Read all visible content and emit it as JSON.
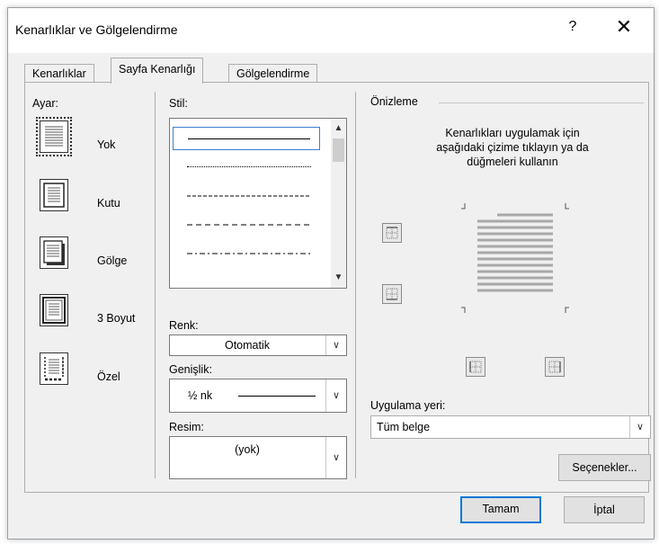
{
  "window": {
    "title": "Kenarlıklar ve Gölgelendirme",
    "help_glyph": "?",
    "close_glyph": "✕"
  },
  "tabs": [
    {
      "label": "Kenarlıklar",
      "underline": "e",
      "active": false
    },
    {
      "label": "Sayfa Kenarlığı",
      "underline": "S",
      "active": true
    },
    {
      "label": "Gölgelendirme",
      "underline": "ö",
      "active": false
    }
  ],
  "setting": {
    "label": "Ayar:",
    "items": [
      {
        "label": "Yok",
        "icon": "setting-none-icon",
        "selected": true
      },
      {
        "label": "Kutu",
        "icon": "setting-box-icon",
        "selected": false
      },
      {
        "label": "Gölge",
        "icon": "setting-shadow-icon",
        "selected": false
      },
      {
        "label": "3 Boyut",
        "icon": "setting-3d-icon",
        "selected": false
      },
      {
        "label": "Özel",
        "icon": "setting-custom-icon",
        "selected": false
      }
    ]
  },
  "style": {
    "label": "Stil:",
    "items": [
      "solid",
      "dotted",
      "dashed-small",
      "dashed-large",
      "dash-dot"
    ]
  },
  "color": {
    "label": "Renk:",
    "value": "Otomatik"
  },
  "width": {
    "label": "Genişlik:",
    "value": "½ nk"
  },
  "art": {
    "label": "Resim:",
    "value": "(yok)"
  },
  "preview": {
    "label": "Önizleme",
    "instructions": [
      "Kenarlıkları uygulamak için",
      "aşağıdaki çizime tıklayın ya da",
      "düğmeleri kullanın"
    ]
  },
  "apply_to": {
    "label": "Uygulama yeri:",
    "value": "Tüm belge"
  },
  "buttons": {
    "options": "Seçenekler...",
    "ok": "Tamam",
    "cancel": "İptal"
  },
  "colors": {
    "dialog_bg": "#f0f0f0",
    "accent": "#0078d7",
    "selection": "#3c7fd0"
  }
}
